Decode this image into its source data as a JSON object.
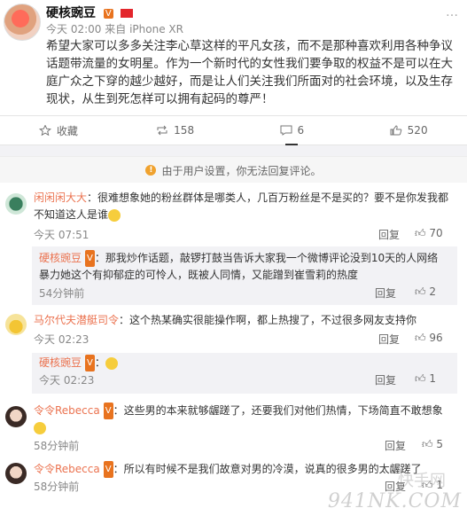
{
  "post": {
    "author": "硬核豌豆",
    "badge": "V",
    "time": "今天 02:00",
    "source_prefix": "来自",
    "source": "iPhone XR",
    "more": "…",
    "text": "希望大家可以多多关注李心草这样的平凡女孩，而不是那种喜欢利用各种争议话题带流量的女明星。作为一个新时代的女性我们要争取的权益不是可以在大庭广众之下穿的越少越好，而是让人们关注我们所面对的社会环境，以及生存现状，从生到死怎样可以拥有起码的尊严！"
  },
  "actions": {
    "favorite": "收藏",
    "repost": "158",
    "comment": "6",
    "like": "520"
  },
  "notice": "由于用户设置，你无法回复评论。",
  "comments": [
    {
      "name": "闲闲闲大大",
      "text": "：很难想象她的粉丝群体是哪类人，几百万粉丝是不是买的？要不是你发我都不知道这人是谁",
      "time": "今天 07:51",
      "reply": "回复",
      "likes": "70"
    },
    {
      "name": "硬核豌豆",
      "badge": "V",
      "text": "：那我炒作话题，敲锣打鼓当告诉大家我一个微博评论没到10天的人网络暴力她这个有抑郁症的可怜人，既被人同情，又能蹭到崔雪莉的热度",
      "time": "54分钟前",
      "reply": "回复",
      "likes": "2"
    },
    {
      "name": "马尔代夫潜艇司令",
      "text": "：这个热某确实很能操作啊，都上热搜了，不过很多网友支持你",
      "time": "今天 02:23",
      "reply": "回复",
      "likes": "96"
    },
    {
      "name": "硬核豌豆",
      "badge": "V",
      "text": "：",
      "time": "今天 02:23",
      "reply": "回复",
      "likes": "1"
    },
    {
      "name": "令令Rebecca",
      "badge": "V",
      "text": "：这些男的本来就够龌蹉了，还要我们对他们热情，下场简直不敢想象",
      "time": "58分钟前",
      "reply": "回复",
      "likes": "5"
    },
    {
      "name": "令令Rebecca",
      "badge": "V",
      "text": "：所以有时候不是我们故意对男的冷漠，说真的很多男的太龌蹉了",
      "time": "58分钟前",
      "reply": "回复",
      "likes": "1"
    }
  ],
  "watermark": "941NK.COM",
  "watermark_cn": "快手网"
}
